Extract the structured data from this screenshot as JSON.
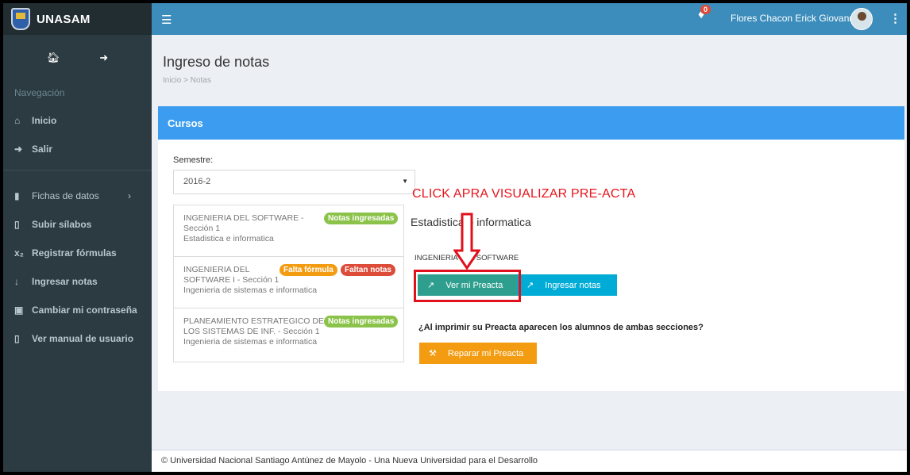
{
  "brand": {
    "name": "UNASAM"
  },
  "sidebar": {
    "nav_header": "Navegación",
    "items": [
      {
        "label": "Inicio",
        "icon": "home-icon"
      },
      {
        "label": "Salir",
        "icon": "sign-out-icon"
      },
      {
        "label": "Fichas de datos",
        "icon": "bar-chart-icon"
      },
      {
        "label": "Subir sílabos",
        "icon": "book-icon"
      },
      {
        "label": "Registrar fórmulas",
        "icon": "subscript-icon"
      },
      {
        "label": "Ingresar notas",
        "icon": "sort-numeric-icon"
      },
      {
        "label": "Cambiar mi contraseña",
        "icon": "lock-icon"
      },
      {
        "label": "Ver manual de usuario",
        "icon": "book-icon"
      }
    ]
  },
  "topbar": {
    "notifications_count": "0",
    "user_name": "Flores Chacon Erick Giovanny"
  },
  "page": {
    "title": "Ingreso de notas",
    "breadcrumb": "Inicio > Notas"
  },
  "box": {
    "header": "Cursos",
    "semester_label": "Semestre:",
    "semester_value": "2016-2"
  },
  "courses": [
    {
      "line1": "INGENIERIA DEL SOFTWARE -",
      "line2": "Sección 1",
      "line3": "Estadistica e informatica",
      "tags": [
        {
          "text": "Notas ingresadas",
          "color": "#8bc34a"
        }
      ]
    },
    {
      "line1": "INGENIERIA DEL",
      "line2": "SOFTWARE I - Sección 1",
      "line3": "Ingenieria de sistemas e informatica",
      "tags": [
        {
          "text": "Falta fórmula",
          "color": "#f39c12"
        },
        {
          "text": "Faltan notas",
          "color": "#dd4b39"
        }
      ]
    },
    {
      "line1": "PLANEAMIENTO ESTRATEGICO DE",
      "line2": "LOS SISTEMAS DE INF. - Sección 1",
      "line3": "Ingenieria de sistemas e informatica",
      "tags": [
        {
          "text": "Notas ingresadas",
          "color": "#8bc34a"
        }
      ]
    }
  ],
  "detail": {
    "annotation": "CLICK APRA VISUALIZAR PRE-ACTA",
    "title": "Estadistica e informatica",
    "subtitle": "INGENIERIA DEL SOFTWARE",
    "btn_preacta": "Ver mi Preacta",
    "btn_notas": "Ingresar notas",
    "question": "¿Al imprimir su Preacta aparecen los alumnos de ambas secciones?",
    "btn_repair": "Reparar mi Preacta"
  },
  "footer": "© Universidad Nacional Santiago Antúnez de Mayolo - Una Nueva Universidad para el Desarrollo"
}
